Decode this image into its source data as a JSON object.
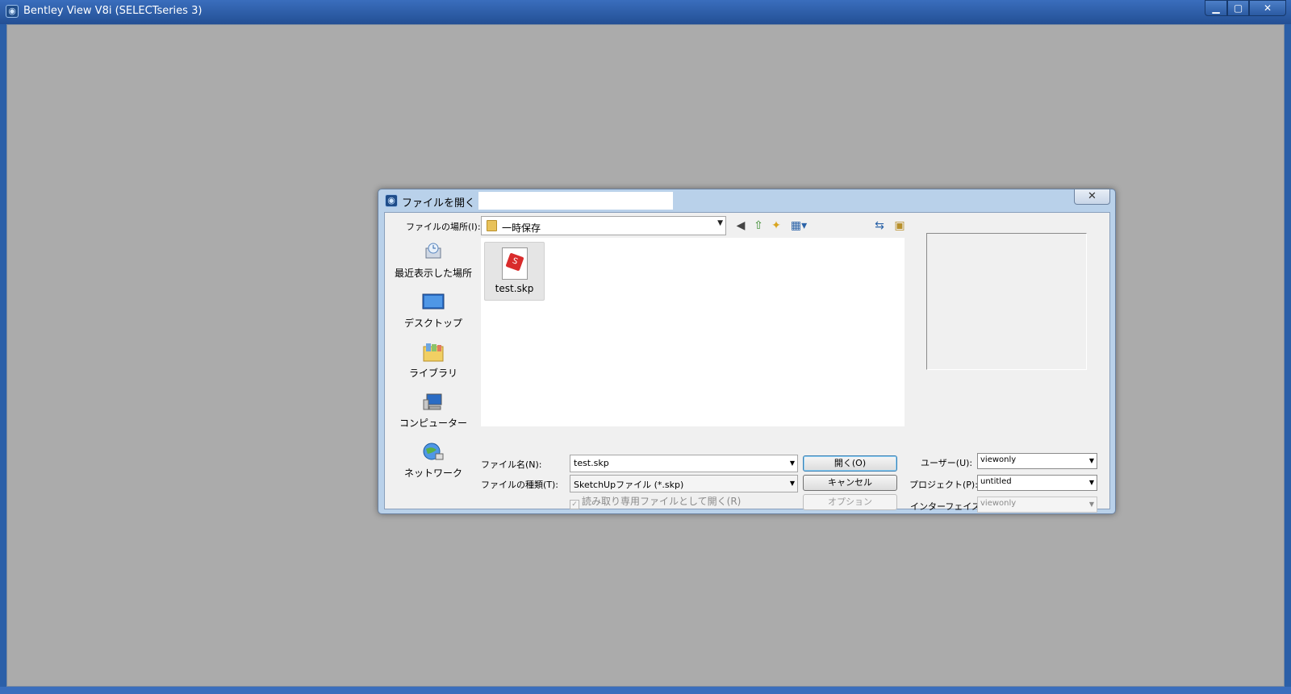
{
  "app": {
    "title": "Bentley View V8i (SELECTseries 3)",
    "minimize": "▁",
    "maximize": "▢",
    "close": "✕"
  },
  "dialog": {
    "title": "ファイルを開く -",
    "close": "✕",
    "look_in_label": "ファイルの場所(I):",
    "look_in_value": "一時保存",
    "places": [
      {
        "label": "最近表示した場所",
        "icon": "recent-places-icon"
      },
      {
        "label": "デスクトップ",
        "icon": "desktop-icon"
      },
      {
        "label": "ライブラリ",
        "icon": "library-icon"
      },
      {
        "label": "コンピューター",
        "icon": "computer-icon"
      },
      {
        "label": "ネットワーク",
        "icon": "network-icon"
      }
    ],
    "files": [
      {
        "name": "test.skp",
        "icon": "sketchup-file-icon"
      }
    ],
    "file_name_label": "ファイル名(N):",
    "file_name_value": "test.skp",
    "file_type_label": "ファイルの種類(T):",
    "file_type_value": "SketchUpファイル (*.skp)",
    "readonly_label": "読み取り専用ファイルとして開く(R)",
    "open_button": "開く(O)",
    "cancel_button": "キャンセル",
    "options_button": "オプション",
    "user_label": "ユーザー(U):",
    "user_value": "viewonly",
    "project_label": "プロジェクト(P):",
    "project_value": "untitled",
    "interface_label": "インターフェイス:",
    "interface_value": "viewonly"
  }
}
